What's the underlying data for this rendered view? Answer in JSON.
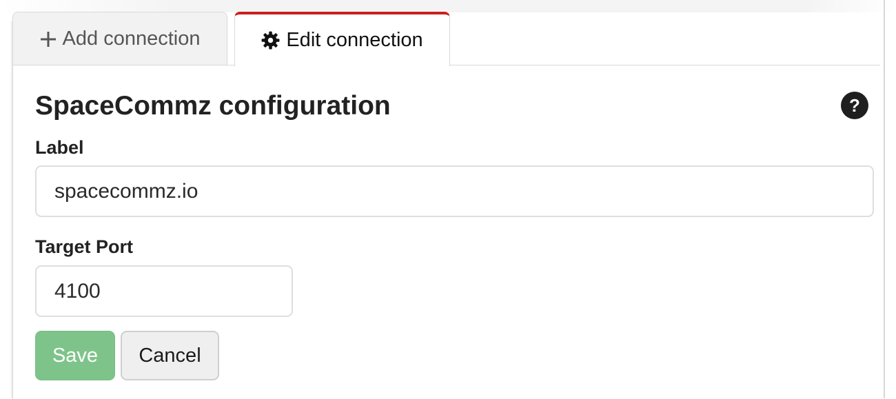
{
  "tabs": {
    "add": {
      "label": "Add connection",
      "icon": "plus-icon"
    },
    "edit": {
      "label": "Edit connection",
      "icon": "gear-icon",
      "active": true
    }
  },
  "config": {
    "title": "SpaceCommz configuration",
    "help_glyph": "?"
  },
  "fields": {
    "label": {
      "label": "Label",
      "value": "spacecommz.io"
    },
    "port": {
      "label": "Target Port",
      "value": "4100"
    }
  },
  "buttons": {
    "save": "Save",
    "cancel": "Cancel"
  },
  "colors": {
    "active_tab_accent": "#cc1f1f",
    "save_button": "#7ec48a"
  }
}
